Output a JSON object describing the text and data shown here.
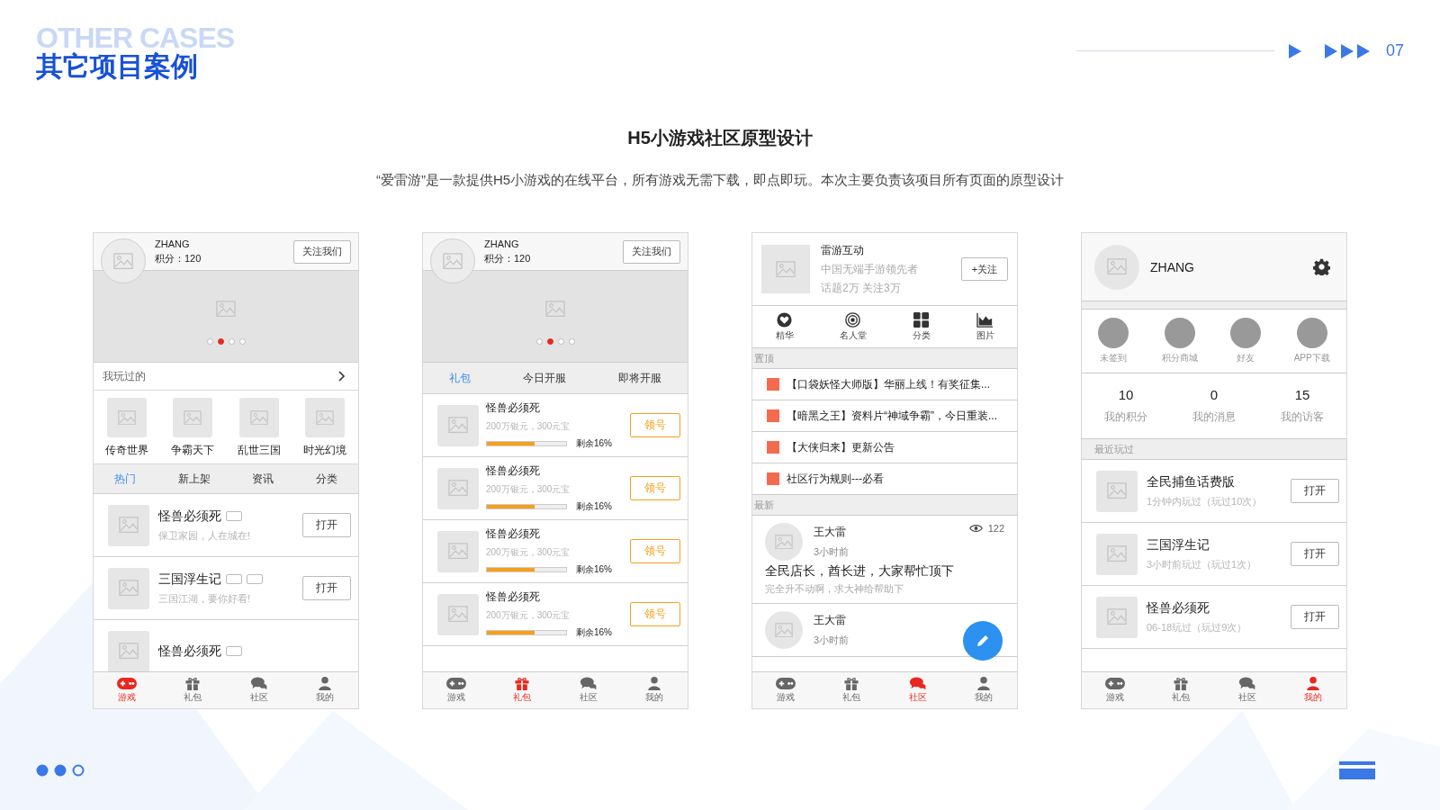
{
  "header": {
    "watermark": "OTHER CASES",
    "title": "其它项目案例",
    "page_number": "07"
  },
  "project": {
    "title": "H5小游戏社区原型设计",
    "description": "“爱雷游”是一款提供H5小游戏的在线平台，所有游戏无需下载，即点即玩。本次主要负责该项目所有页面的原型设计"
  },
  "phones": [
    {
      "kind": "games",
      "user": {
        "name": "ZHANG",
        "points": "积分：120"
      },
      "follow_button": "关注我们",
      "carousel": [
        {
          "selected": false
        },
        {
          "selected": true
        },
        {
          "selected": false
        },
        {
          "selected": false
        }
      ],
      "played_header": "我玩过的",
      "played": [
        "传奇世界",
        "争霸天下",
        "乱世三国",
        "时光幻境"
      ],
      "tabs": [
        {
          "label": "热门",
          "selected": true
        },
        {
          "label": "新上架",
          "selected": false
        },
        {
          "label": "资讯",
          "selected": false
        },
        {
          "label": "分类",
          "selected": false
        }
      ],
      "games": [
        {
          "title": "怪兽必须死",
          "subtitle": "保卫家园，人在城在!",
          "tags": [
            {
              "kind": "blank"
            }
          ],
          "button": "打开"
        },
        {
          "title": "三国浮生记",
          "subtitle": "三国江湖，要你好看!",
          "tags": [
            {
              "kind": "blank"
            },
            {
              "kind": "blank"
            }
          ],
          "button": "打开"
        },
        {
          "title": "怪兽必须死",
          "tags": [
            {
              "kind": "blank"
            }
          ]
        }
      ],
      "nav": [
        {
          "label": "游戏",
          "selected": true
        },
        {
          "label": "礼包",
          "selected": false
        },
        {
          "label": "社区",
          "selected": false
        },
        {
          "label": "我的",
          "selected": false
        }
      ]
    },
    {
      "kind": "gifts",
      "user": {
        "name": "ZHANG",
        "points": "积分：120"
      },
      "follow_button": "关注我们",
      "carousel": [
        {
          "selected": false
        },
        {
          "selected": true
        },
        {
          "selected": false
        },
        {
          "selected": false
        }
      ],
      "tabs": [
        {
          "label": "礼包",
          "selected": true
        },
        {
          "label": "今日开服",
          "selected": false
        },
        {
          "label": "即将开服",
          "selected": false
        }
      ],
      "gifts": [
        {
          "title": "怪兽必须死",
          "subtitle": "200万银元，300元宝",
          "level": 0.6,
          "remaining": "剩余16%",
          "button": "领号"
        },
        {
          "title": "怪兽必须死",
          "subtitle": "200万银元，300元宝",
          "level": 0.6,
          "remaining": "剩余16%",
          "button": "领号"
        },
        {
          "title": "怪兽必须死",
          "subtitle": "200万银元，300元宝",
          "level": 0.6,
          "remaining": "剩余16%",
          "button": "领号"
        },
        {
          "title": "怪兽必须死",
          "subtitle": "200万银元，300元宝",
          "level": 0.6,
          "remaining": "剩余16%",
          "button": "领号"
        }
      ],
      "nav": [
        {
          "label": "游戏",
          "selected": false
        },
        {
          "label": "礼包",
          "selected": true
        },
        {
          "label": "社区",
          "selected": false
        },
        {
          "label": "我的",
          "selected": false
        }
      ]
    },
    {
      "kind": "community",
      "club": {
        "name": "雷游互动",
        "tagline": "中国无端手游领先者",
        "stats": "话题2万 关注3万",
        "button": "+关注"
      },
      "shortcuts": [
        {
          "kind": "heart",
          "label": "精华"
        },
        {
          "kind": "target",
          "label": "名人堂"
        },
        {
          "kind": "grid",
          "label": "分类"
        },
        {
          "kind": "chart",
          "label": "图片"
        }
      ],
      "pinned_header": "置顶",
      "pinned": [
        "【口袋妖怪大师版】华丽上线！有奖征集...",
        "【暗黑之王】资料片“神域争霸”，今日重装...",
        "【大侠归来】更新公告",
        "社区行为规则---必看"
      ],
      "latest_header": "最新",
      "posts": [
        {
          "author": "王大雷",
          "time": "3小时前",
          "views": "122",
          "title": "全民店长，酋长进，大家帮忙顶下",
          "body": "完全升不动啊，求大神给帮助下"
        },
        {
          "author": "王大雷",
          "time": "3小时前"
        }
      ],
      "nav": [
        {
          "label": "游戏",
          "selected": false
        },
        {
          "label": "礼包",
          "selected": false
        },
        {
          "label": "社区",
          "selected": true
        },
        {
          "label": "我的",
          "selected": false
        }
      ]
    },
    {
      "kind": "profile",
      "user": {
        "name": "ZHANG"
      },
      "shortcuts": [
        "未签到",
        "积分商城",
        "好友",
        "APP下载"
      ],
      "stats": [
        {
          "value": "10",
          "label": "我的积分"
        },
        {
          "value": "0",
          "label": "我的消息"
        },
        {
          "value": "15",
          "label": "我的访客"
        }
      ],
      "recent_header": "最近玩过",
      "recent": [
        {
          "title": "全民捕鱼话费版",
          "subtitle": "1分钟内玩过（玩过10次）",
          "button": "打开"
        },
        {
          "title": "三国浮生记",
          "subtitle": "3小时前玩过（玩过1次）",
          "button": "打开"
        },
        {
          "title": "怪兽必须死",
          "subtitle": "06-18玩过（玩过9次）",
          "button": "打开"
        }
      ],
      "nav": [
        {
          "label": "游戏",
          "selected": false
        },
        {
          "label": "礼包",
          "selected": false
        },
        {
          "label": "社区",
          "selected": false
        },
        {
          "label": "我的",
          "selected": true
        }
      ]
    }
  ]
}
